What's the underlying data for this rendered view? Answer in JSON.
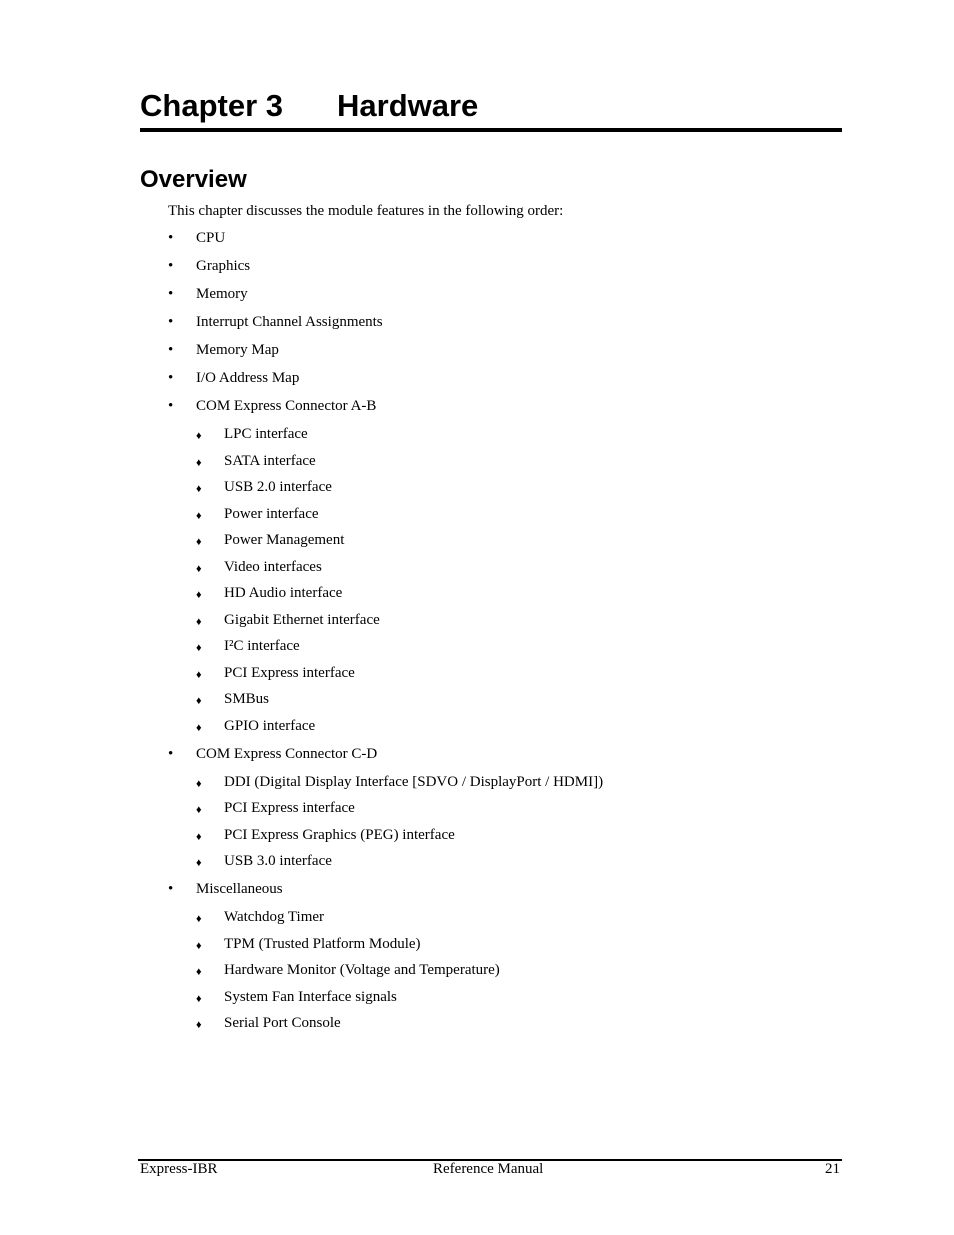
{
  "header": {
    "chapter_number": "Chapter 3",
    "chapter_title": "Hardware"
  },
  "section": {
    "title": "Overview",
    "intro": "This chapter discusses the module features in the following order:"
  },
  "bullet_glyphs": {
    "level1": "•",
    "level2": "♦"
  },
  "items": [
    {
      "level": 1,
      "text": "CPU"
    },
    {
      "level": 1,
      "text": "Graphics"
    },
    {
      "level": 1,
      "text": "Memory"
    },
    {
      "level": 1,
      "text": "Interrupt Channel Assignments"
    },
    {
      "level": 1,
      "text": "Memory Map"
    },
    {
      "level": 1,
      "text": "I/O Address Map"
    },
    {
      "level": 1,
      "text": "COM Express Connector A-B"
    },
    {
      "level": 2,
      "text": "LPC interface"
    },
    {
      "level": 2,
      "text": "SATA interface"
    },
    {
      "level": 2,
      "text": "USB 2.0 interface"
    },
    {
      "level": 2,
      "text": "Power interface"
    },
    {
      "level": 2,
      "text": "Power Management"
    },
    {
      "level": 2,
      "text": "Video interfaces"
    },
    {
      "level": 2,
      "text": "HD Audio interface"
    },
    {
      "level": 2,
      "text": "Gigabit Ethernet interface"
    },
    {
      "level": 2,
      "text": "I²C interface"
    },
    {
      "level": 2,
      "text": "PCI Express interface"
    },
    {
      "level": 2,
      "text": "SMBus"
    },
    {
      "level": 2,
      "text": "GPIO interface"
    },
    {
      "level": 1,
      "text": "COM Express Connector C-D"
    },
    {
      "level": 2,
      "text": "DDI (Digital Display Interface [SDVO / DisplayPort / HDMI])"
    },
    {
      "level": 2,
      "text": "PCI Express interface"
    },
    {
      "level": 2,
      "text": "PCI Express Graphics (PEG) interface"
    },
    {
      "level": 2,
      "text": "USB 3.0 interface"
    },
    {
      "level": 1,
      "text": "Miscellaneous"
    },
    {
      "level": 2,
      "text": "Watchdog Timer"
    },
    {
      "level": 2,
      "text": "TPM (Trusted Platform Module)"
    },
    {
      "level": 2,
      "text": "Hardware Monitor (Voltage and Temperature)"
    },
    {
      "level": 2,
      "text": "System Fan Interface signals"
    },
    {
      "level": 2,
      "text": "Serial Port Console"
    }
  ],
  "footer": {
    "left": "Express-IBR",
    "center": "Reference Manual",
    "right": "21"
  }
}
